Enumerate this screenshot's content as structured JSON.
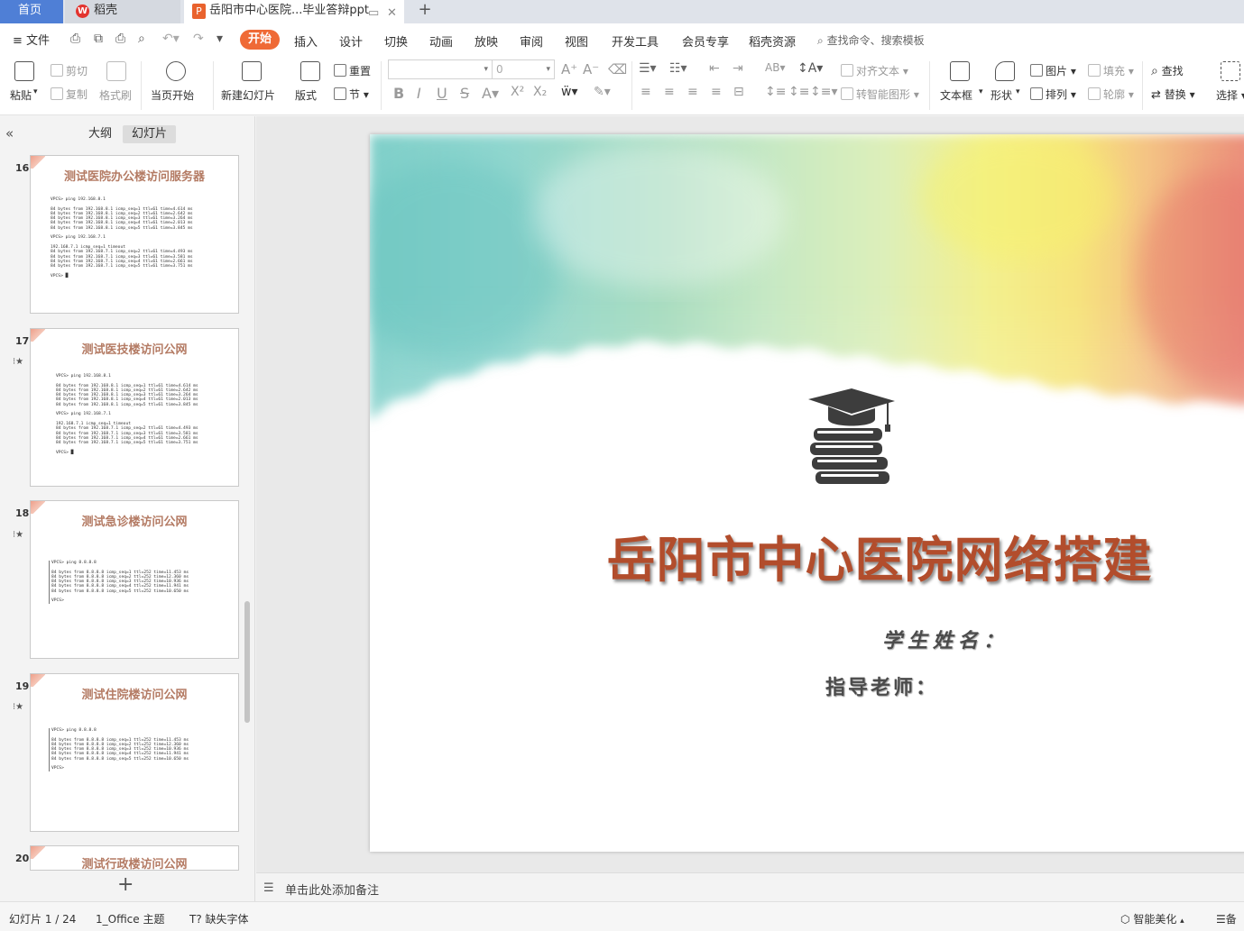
{
  "titlebar": {
    "home_tab": "首页",
    "daoke_tab": "稻壳",
    "daoke_logo": "W",
    "doc_tab": "岳阳市中心医院...毕业答辩ppt",
    "doc_icon": "P",
    "close_glyph": "✕",
    "add_glyph": "+"
  },
  "menubar": {
    "file_label": "≡ 文件",
    "items": [
      "开始",
      "插入",
      "设计",
      "切换",
      "动画",
      "放映",
      "审阅",
      "视图",
      "开发工具",
      "会员专享",
      "稻壳资源"
    ],
    "active_index": 0,
    "search_label": "查找命令、搜索模板"
  },
  "ribbon": {
    "paste": "粘贴",
    "cut": "剪切",
    "copy": "复制",
    "format_painter": "格式刷",
    "play_from_current": "当页开始",
    "new_slide": "新建幻灯片",
    "layout": "版式",
    "reset": "重置",
    "section": "节",
    "font_size_value": "0",
    "align_text": "对齐文本",
    "smart_art": "转智能图形",
    "text_box": "文本框",
    "shape": "形状",
    "picture": "图片",
    "arrange": "排列",
    "fill": "填充",
    "outline": "轮廓",
    "find": "查找",
    "replace": "替换",
    "select": "选择"
  },
  "left_panel": {
    "tab_outline": "大纲",
    "tab_slides": "幻灯片",
    "collapse_glyph": "«",
    "add_glyph": "+",
    "thumbnails": [
      {
        "number": "16",
        "title": "测试医院办公楼访问服务器",
        "has_star": false,
        "cli": "VPCS> ping 192.168.8.1\n\n84 bytes from 192.168.8.1 icmp_seq=1 ttl=61 time=4.614 ms\n84 bytes from 192.168.8.1 icmp_seq=2 ttl=61 time=2.642 ms\n84 bytes from 192.168.8.1 icmp_seq=3 ttl=61 time=3.264 ms\n84 bytes from 192.168.8.1 icmp_seq=4 ttl=61 time=2.013 ms\n84 bytes from 192.168.8.1 icmp_seq=5 ttl=61 time=3.845 ms\n\nVPCS> ping 192.168.7.1\n\n192.168.7.1 icmp_seq=1 timeout\n84 bytes from 192.168.7.1 icmp_seq=2 ttl=61 time=4.493 ms\n84 bytes from 192.168.7.1 icmp_seq=3 ttl=61 time=3.581 ms\n84 bytes from 192.168.7.1 icmp_seq=4 ttl=61 time=2.661 ms\n84 bytes from 192.168.7.1 icmp_seq=5 ttl=61 time=3.751 ms\n\nVPCS> █"
      },
      {
        "number": "17",
        "title": "测试医技楼访问公网",
        "has_star": true,
        "cli": "VPCS> ping 192.168.8.1\n\n84 bytes from 192.168.8.1 icmp_seq=1 ttl=61 time=4.614 ms\n84 bytes from 192.168.8.1 icmp_seq=2 ttl=61 time=2.642 ms\n84 bytes from 192.168.8.1 icmp_seq=3 ttl=61 time=3.264 ms\n84 bytes from 192.168.8.1 icmp_seq=4 ttl=61 time=2.013 ms\n84 bytes from 192.168.8.1 icmp_seq=5 ttl=61 time=3.845 ms\n\nVPCS> ping 192.168.7.1\n\n192.168.7.1 icmp_seq=1 timeout\n84 bytes from 192.168.7.1 icmp_seq=2 ttl=61 time=4.493 ms\n84 bytes from 192.168.7.1 icmp_seq=3 ttl=61 time=3.581 ms\n84 bytes from 192.168.7.1 icmp_seq=4 ttl=61 time=2.661 ms\n84 bytes from 192.168.7.1 icmp_seq=5 ttl=61 time=3.751 ms\n\nVPCS> █"
      },
      {
        "number": "18",
        "title": "测试急诊楼访问公网",
        "has_star": true,
        "cli": "VPCS> ping 8.8.8.8\n\n84 bytes from 8.8.8.8 icmp_seq=1 ttl=252 time=11.453 ms\n84 bytes from 8.8.8.8 icmp_seq=2 ttl=252 time=12.360 ms\n84 bytes from 8.8.8.8 icmp_seq=3 ttl=252 time=10.936 ms\n84 bytes from 8.8.8.8 icmp_seq=4 ttl=252 time=11.941 ms\n84 bytes from 8.8.8.8 icmp_seq=5 ttl=252 time=10.650 ms\n\nVPCS>"
      },
      {
        "number": "19",
        "title": "测试住院楼访问公网",
        "has_star": true,
        "cli": "VPCS> ping 8.8.8.8\n\n84 bytes from 8.8.8.8 icmp_seq=1 ttl=252 time=11.453 ms\n84 bytes from 8.8.8.8 icmp_seq=2 ttl=252 time=12.360 ms\n84 bytes from 8.8.8.8 icmp_seq=3 ttl=252 time=10.936 ms\n84 bytes from 8.8.8.8 icmp_seq=4 ttl=252 time=11.941 ms\n84 bytes from 8.8.8.8 icmp_seq=5 ttl=252 time=10.650 ms\n\nVPCS>"
      },
      {
        "number": "20",
        "title": "测试行政楼访问公网",
        "has_star": false,
        "cli": ""
      }
    ]
  },
  "slide": {
    "title": "岳阳市中心医院网络搭建",
    "student_label": "学生姓名：",
    "teacher_label": "指导老师：",
    "title_color": "#b24d2c",
    "icon": "graduation-cap-books-icon"
  },
  "notes": {
    "placeholder": "单击此处添加备注"
  },
  "statusbar": {
    "slide_counter": "幻灯片 1 / 24",
    "theme": "1_Office 主题",
    "missing_font": "缺失字体",
    "beautify": "智能美化",
    "notes_btn": "备"
  },
  "colors": {
    "accent": "#ef6a36",
    "home_tab": "#4f7fd6"
  }
}
